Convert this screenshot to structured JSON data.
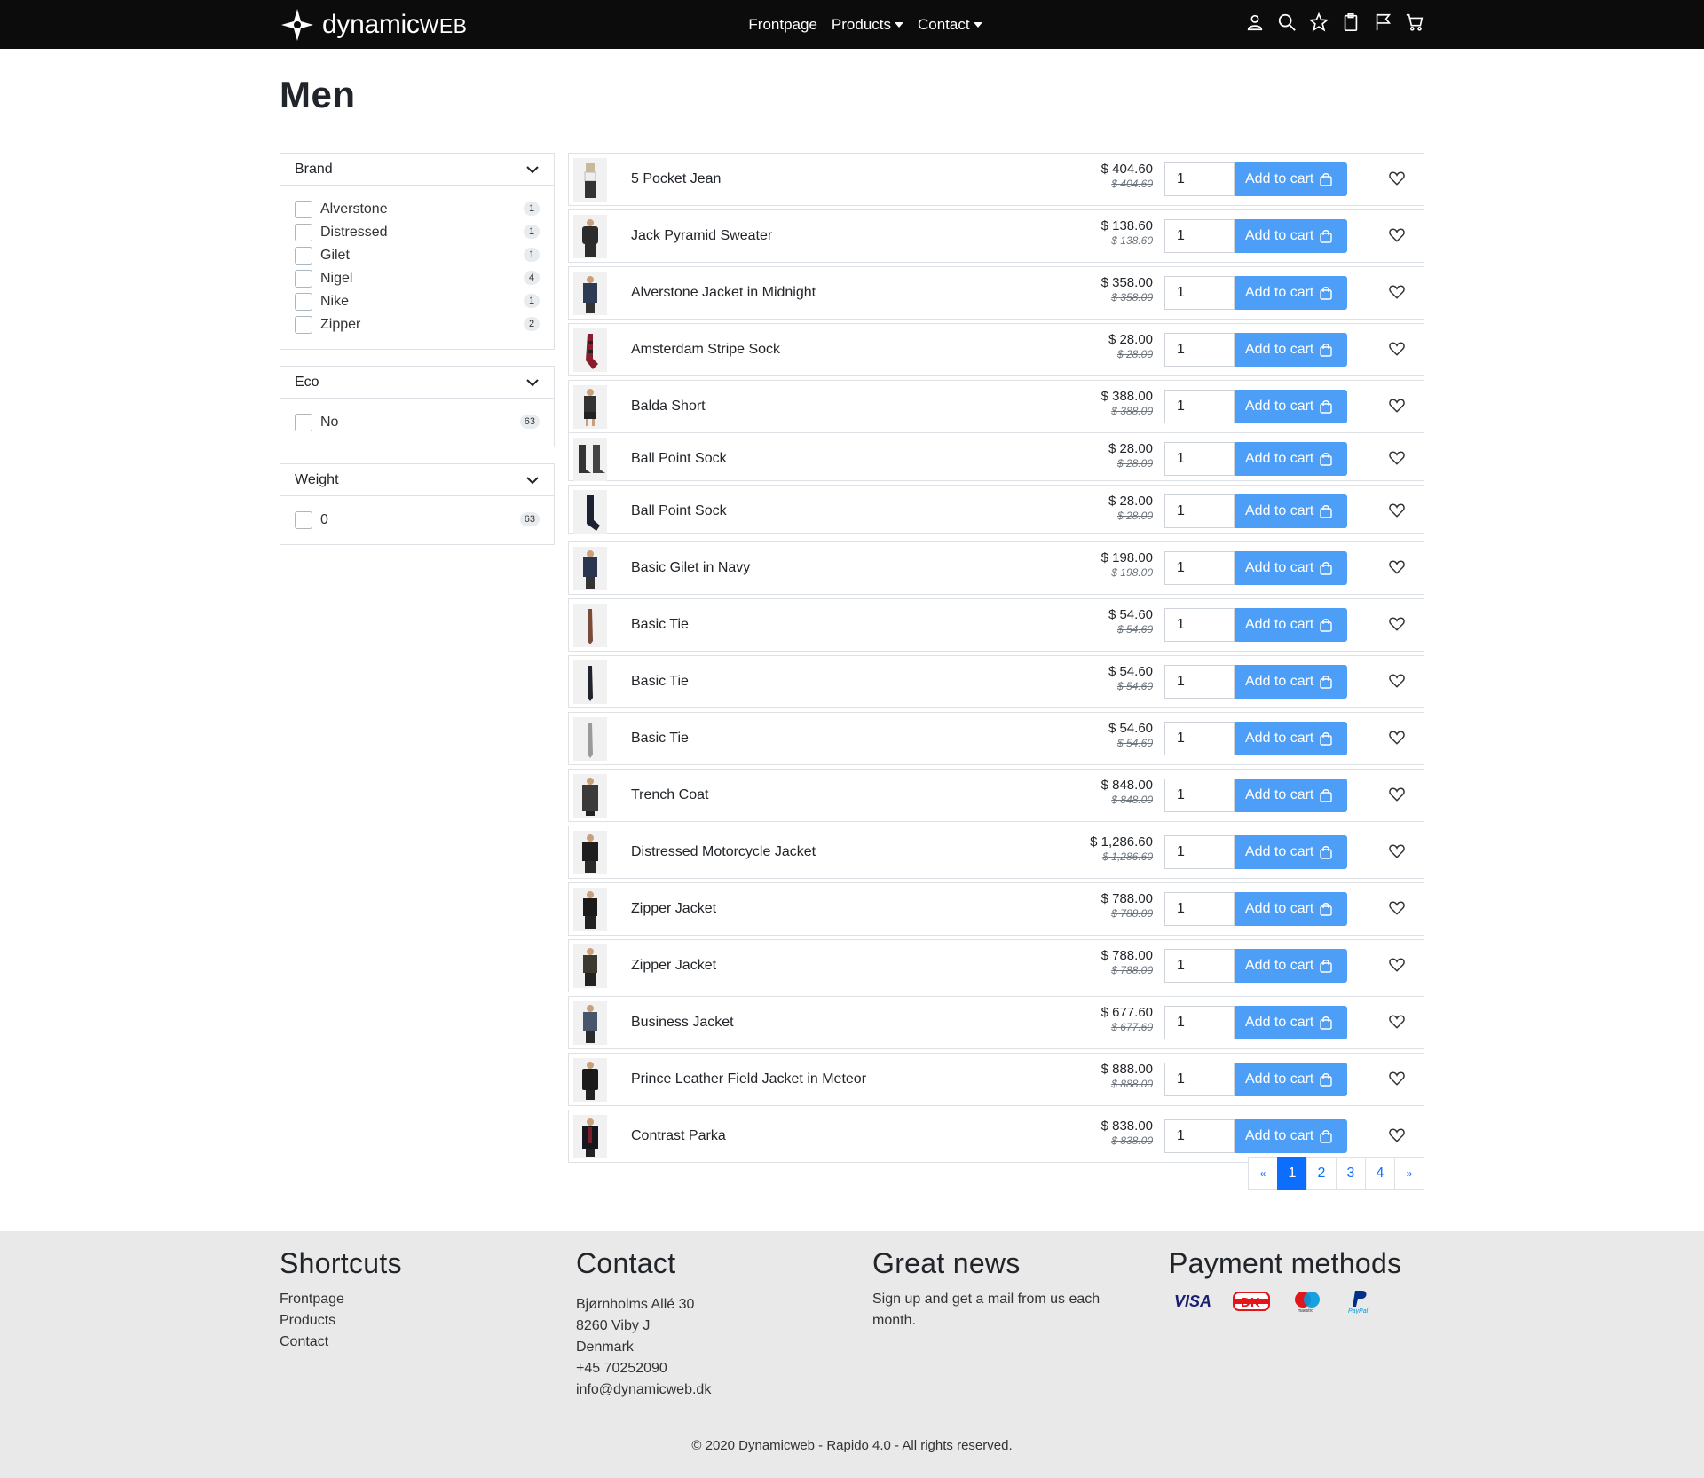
{
  "brand": {
    "logo_text_main": "dynamic",
    "logo_text_suffix": "WEB"
  },
  "nav": {
    "items": [
      {
        "label": "Frontpage",
        "dropdown": false
      },
      {
        "label": "Products",
        "dropdown": true
      },
      {
        "label": "Contact",
        "dropdown": true
      }
    ]
  },
  "page": {
    "title": "Men"
  },
  "facets": [
    {
      "title": "Brand",
      "options": [
        {
          "label": "Alverstone",
          "count": "1"
        },
        {
          "label": "Distressed",
          "count": "1"
        },
        {
          "label": "Gilet",
          "count": "1"
        },
        {
          "label": "Nigel",
          "count": "4"
        },
        {
          "label": "Nike",
          "count": "1"
        },
        {
          "label": "Zipper",
          "count": "2"
        }
      ]
    },
    {
      "title": "Eco",
      "options": [
        {
          "label": "No",
          "count": "63"
        }
      ]
    },
    {
      "title": "Weight",
      "options": [
        {
          "label": "0",
          "count": "63"
        }
      ]
    }
  ],
  "products": [
    {
      "name": "5 Pocket Jean",
      "price": "$ 404.60",
      "old_price": "$ 404.60",
      "qty": "1"
    },
    {
      "name": "Jack Pyramid Sweater",
      "price": "$ 138.60",
      "old_price": "$ 138.60",
      "qty": "1"
    },
    {
      "name": "Alverstone Jacket in Midnight",
      "price": "$ 358.00",
      "old_price": "$ 358.00",
      "qty": "1"
    },
    {
      "name": "Amsterdam Stripe Sock",
      "price": "$ 28.00",
      "old_price": "$ 28.00",
      "qty": "1"
    },
    {
      "name": "Balda Short",
      "price": "$ 388.00",
      "old_price": "$ 388.00",
      "qty": "1"
    },
    {
      "name": "Ball Point Sock",
      "price": "$ 28.00",
      "old_price": "$ 28.00",
      "qty": "1"
    },
    {
      "name": "Ball Point Sock",
      "price": "$ 28.00",
      "old_price": "$ 28.00",
      "qty": "1"
    },
    {
      "name": "Basic Gilet in Navy",
      "price": "$ 198.00",
      "old_price": "$ 198.00",
      "qty": "1"
    },
    {
      "name": "Basic Tie",
      "price": "$ 54.60",
      "old_price": "$ 54.60",
      "qty": "1"
    },
    {
      "name": "Basic Tie",
      "price": "$ 54.60",
      "old_price": "$ 54.60",
      "qty": "1"
    },
    {
      "name": "Basic Tie",
      "price": "$ 54.60",
      "old_price": "$ 54.60",
      "qty": "1"
    },
    {
      "name": "Trench Coat",
      "price": "$ 848.00",
      "old_price": "$ 848.00",
      "qty": "1"
    },
    {
      "name": "Distressed Motorcycle Jacket",
      "price": "$ 1,286.60",
      "old_price": "$ 1,286.60",
      "qty": "1"
    },
    {
      "name": "Zipper Jacket",
      "price": "$ 788.00",
      "old_price": "$ 788.00",
      "qty": "1"
    },
    {
      "name": "Zipper Jacket",
      "price": "$ 788.00",
      "old_price": "$ 788.00",
      "qty": "1"
    },
    {
      "name": "Business Jacket",
      "price": "$ 677.60",
      "old_price": "$ 677.60",
      "qty": "1"
    },
    {
      "name": "Prince Leather Field Jacket in Meteor",
      "price": "$ 888.00",
      "old_price": "$ 888.00",
      "qty": "1"
    },
    {
      "name": "Contrast Parka",
      "price": "$ 838.00",
      "old_price": "$ 838.00",
      "qty": "1"
    }
  ],
  "add_to_cart_label": "Add to cart",
  "pagination": {
    "prev": "«",
    "pages": [
      "1",
      "2",
      "3",
      "4"
    ],
    "active": "1",
    "next": "»"
  },
  "footer": {
    "shortcuts": {
      "title": "Shortcuts",
      "links": [
        "Frontpage",
        "Products",
        "Contact"
      ]
    },
    "contact": {
      "title": "Contact",
      "lines": [
        "Bjørnholms Allé 30",
        "8260 Viby J",
        "Denmark",
        "+45 70252090",
        "info@dynamicweb.dk"
      ]
    },
    "news": {
      "title": "Great news",
      "lines": [
        "Sign up and get a mail from us each",
        "month."
      ]
    },
    "payment": {
      "title": "Payment methods",
      "methods": [
        "VISA",
        "DK",
        "maestro",
        "PayPal"
      ]
    },
    "copyright": "© 2020 Dynamicweb - Rapido 4.0 - All rights reserved."
  },
  "colors": {
    "navbar": "#0c0c0c",
    "button": "#4c9ef7",
    "active_page": "#0d6efd",
    "footer_bg": "#e9e9e9"
  }
}
